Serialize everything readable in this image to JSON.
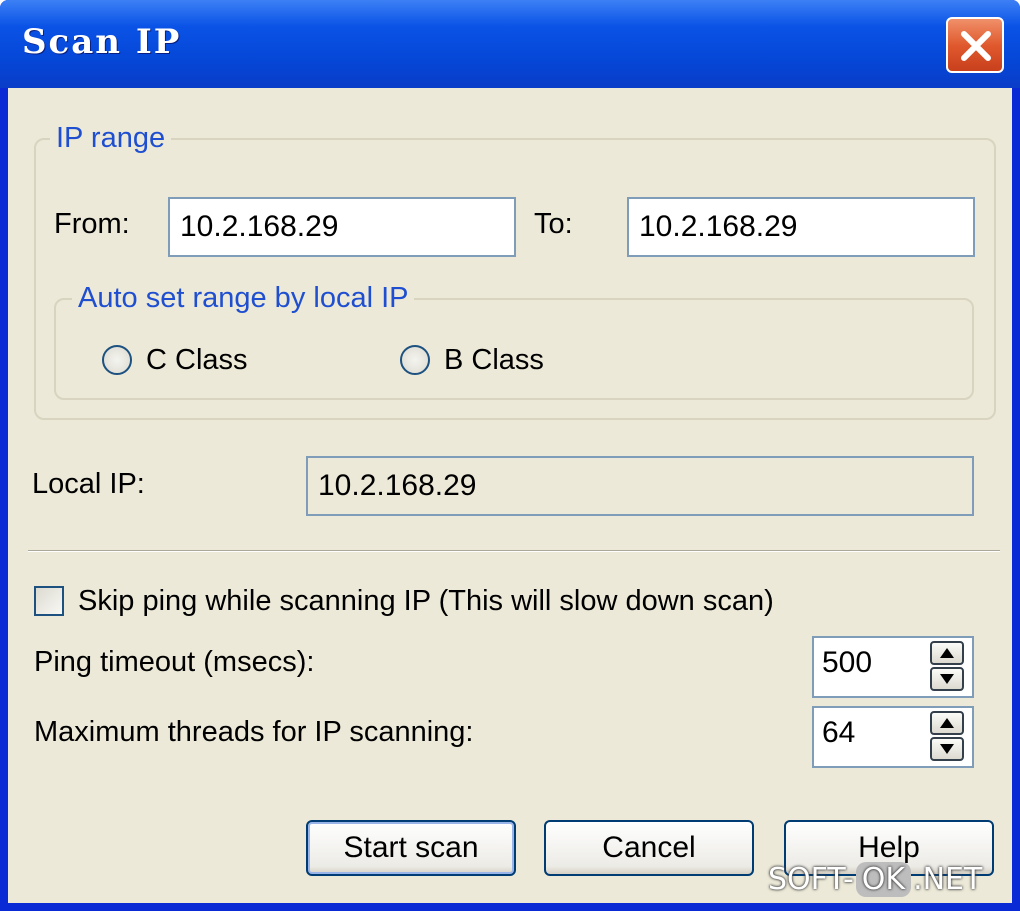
{
  "window": {
    "title": "Scan IP",
    "close_icon": "close-icon"
  },
  "ip_range": {
    "legend": "IP range",
    "from_label": "From:",
    "from_value": "10.2.168.29",
    "to_label": "To:",
    "to_value": "10.2.168.29",
    "auto_set": {
      "legend": "Auto set range by local IP",
      "options": [
        "C Class",
        "B Class"
      ],
      "selected": null
    }
  },
  "local_ip": {
    "label": "Local IP:",
    "value": "10.2.168.29"
  },
  "skip_ping": {
    "label": "Skip ping while scanning IP (This will slow down scan)",
    "checked": false
  },
  "ping_timeout": {
    "label": "Ping timeout (msecs):",
    "value": "500"
  },
  "max_threads": {
    "label": "Maximum threads for IP scanning:",
    "value": "64"
  },
  "buttons": {
    "start_scan": "Start scan",
    "cancel": "Cancel",
    "help": "Help"
  },
  "watermark": {
    "left": "SOFT-",
    "middle": "OK",
    "right": ".NET"
  },
  "colors": {
    "titlebar": "#0a53e6",
    "dialog_bg": "#ece9d8",
    "group_legend": "#1f4fd0",
    "close_button": "#e05a2e"
  }
}
